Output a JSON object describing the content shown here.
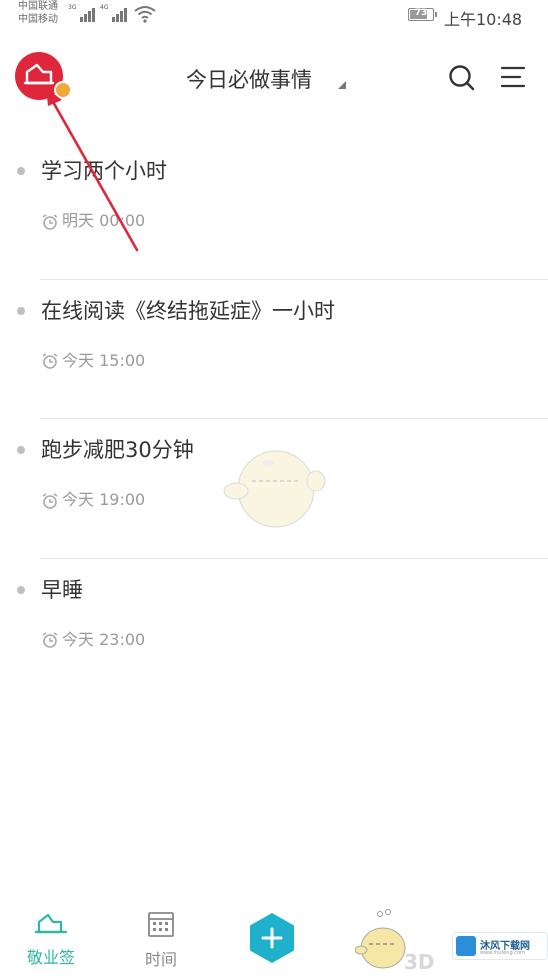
{
  "status_bar": {
    "carrier_1": "中国联通",
    "carrier_2": "中国移动",
    "net_1": "3G",
    "net_2": "4G",
    "battery": "73",
    "time": "上午10:48"
  },
  "header": {
    "title": "今日必做事情",
    "avatar_icon": "cloud-logo-icon",
    "search_icon": "search-icon",
    "menu_icon": "menu-icon"
  },
  "tasks": [
    {
      "title": "学习两个小时",
      "time": "明天 00:00"
    },
    {
      "title": "在线阅读《终结拖延症》一小时",
      "time": "今天 15:00"
    },
    {
      "title": "跑步减肥30分钟",
      "time": "今天 19:00"
    },
    {
      "title": "早睡",
      "time": "今天 23:00"
    }
  ],
  "tabbar": {
    "home_label": "敬业签",
    "time_label": "时间",
    "add_icon": "plus-icon"
  },
  "watermark": {
    "text": "沐风下载网",
    "sub": "www.mufeng.com",
    "mark": "3D"
  },
  "colors": {
    "accent": "#2fb7a3",
    "avatar": "#e0263a",
    "fab": "#1fb0cc",
    "arrow": "#e0263a"
  }
}
